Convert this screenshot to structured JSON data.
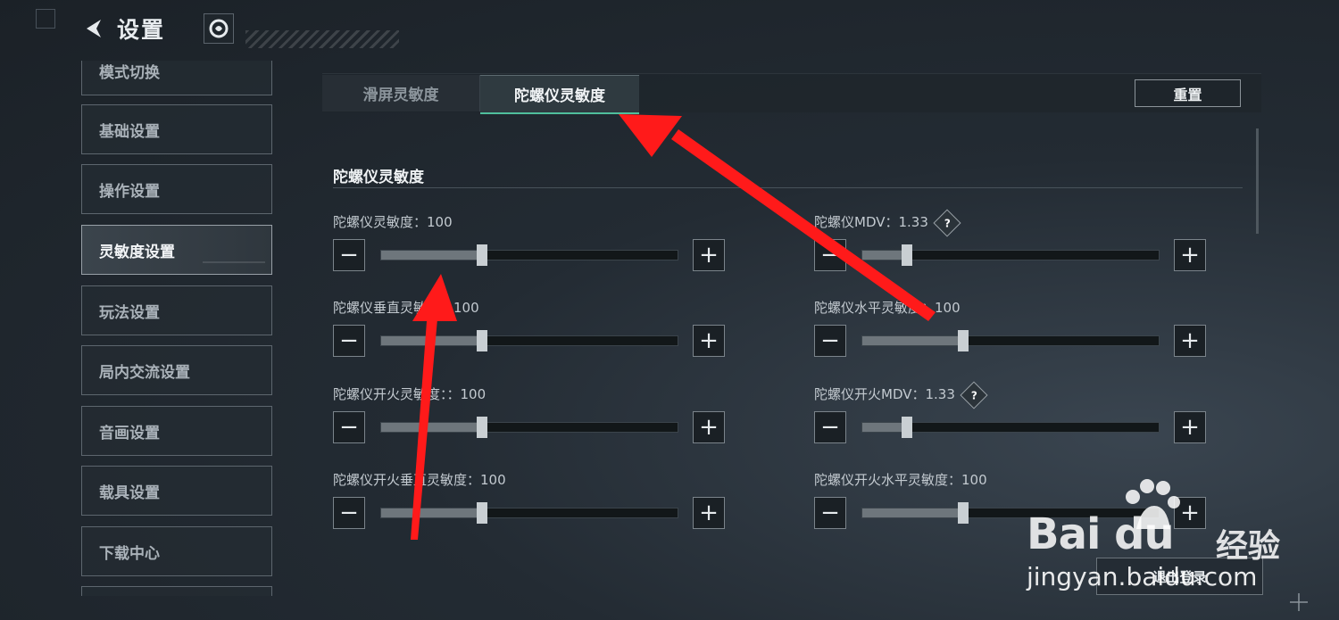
{
  "header": {
    "title": "设置",
    "back_icon": "back-arrow-icon",
    "badge_icon": "leaf-badge-icon"
  },
  "sidebar": {
    "items": [
      {
        "label": "模式切换",
        "active": false
      },
      {
        "label": "基础设置",
        "active": false
      },
      {
        "label": "操作设置",
        "active": false
      },
      {
        "label": "灵敏度设置",
        "active": true
      },
      {
        "label": "玩法设置",
        "active": false
      },
      {
        "label": "局内交流设置",
        "active": false
      },
      {
        "label": "音画设置",
        "active": false
      },
      {
        "label": "载具设置",
        "active": false
      },
      {
        "label": "下载中心",
        "active": false
      }
    ]
  },
  "tabs": [
    {
      "label": "滑屏灵敏度",
      "active": false
    },
    {
      "label": "陀螺仪灵敏度",
      "active": true
    }
  ],
  "reset_label": "重置",
  "section_title": "陀螺仪灵敏度",
  "settings": [
    {
      "label": "陀螺仪灵敏度：100",
      "fraction": 0.34,
      "help": false
    },
    {
      "label": "陀螺仪MDV：1.33",
      "fraction": 0.15,
      "help": true
    },
    {
      "label": "陀螺仪垂直灵敏度：100",
      "fraction": 0.34,
      "help": false
    },
    {
      "label": "陀螺仪水平灵敏度：100",
      "fraction": 0.34,
      "help": false
    },
    {
      "label": "陀螺仪开火灵敏度：：100",
      "fraction": 0.34,
      "help": false
    },
    {
      "label": "陀螺仪开火MDV：1.33",
      "fraction": 0.15,
      "help": true
    },
    {
      "label": "陀螺仪开火垂直灵敏度：100",
      "fraction": 0.34,
      "help": false
    },
    {
      "label": "陀螺仪开火水平灵敏度：100",
      "fraction": 0.34,
      "help": false
    }
  ],
  "controls": {
    "minus": "−",
    "plus": "+",
    "help": "?"
  },
  "bottom_button_label": "退出登录",
  "watermark": {
    "logo_text": "Bai du",
    "brand": "经验",
    "url": "jingyan.baidu.com"
  },
  "colors": {
    "accent": "#4fbf9c",
    "arrow": "#ff1a1a"
  }
}
